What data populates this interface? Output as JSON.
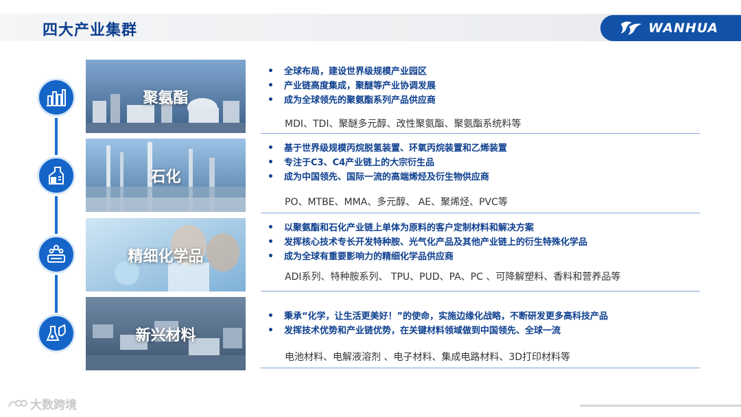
{
  "header": {
    "title": "四大产业集群",
    "logo_text": "WANHUA"
  },
  "segments": [
    {
      "title": "聚氨酯",
      "icon": "chart-bars-icon",
      "bullets": [
        "全球布局，建设世界级规模产业园区",
        "产业链高度集成，聚醚等产业协调发展",
        "成为全球领先的聚氨酯系列产品供应商"
      ],
      "products": "MDI、TDI、聚醚多元醇、改性聚氨酯、聚氨酯系统料等"
    },
    {
      "title": "石化",
      "icon": "flask-icon",
      "bullets": [
        "基于世界级规模丙烷脱氢装置、环氧丙烷装置和乙烯装置",
        "专注于C3、C4产业链上的大宗衍生品",
        "成为中国领先、国际一流的高端烯烃及衍生物供应商"
      ],
      "products": "PO、MTBE、MMA、多元醇、 AE、聚烯烃、PVC等"
    },
    {
      "title": "精细化学品",
      "icon": "molecule-device-icon",
      "bullets": [
        "以聚氨酯和石化产业链上单体为原料的客户定制材料和解决方案",
        "发挥核心技术专长开发特种胺、光气化产品及其他产业链上的衍生特殊化学品",
        "成为全球有重要影响力的精细化学品供应商"
      ],
      "products": "ADI系列、特种胺系列、 TPU、PUD、PA、PC 、可降解塑料、香料和营养品等"
    },
    {
      "title": "新兴材料",
      "icon": "lab-beakers-icon",
      "bullets": [
        "秉承“化学，让生活更美好！”的使命，实施边缘化战略，不断研发更多高科技产品",
        "发挥技术优势和产业链优势，在关键材料领域做到中国领先、全球一流"
      ],
      "products": "电池材料、电解液溶剂 、电子材料、集成电路材料、3D打印材料等"
    }
  ],
  "watermark": "大数跨境",
  "colors": {
    "brand_blue": "#1152a8",
    "title_blue": "#0d3f8f",
    "timeline_blue": "#1a6fd0"
  }
}
